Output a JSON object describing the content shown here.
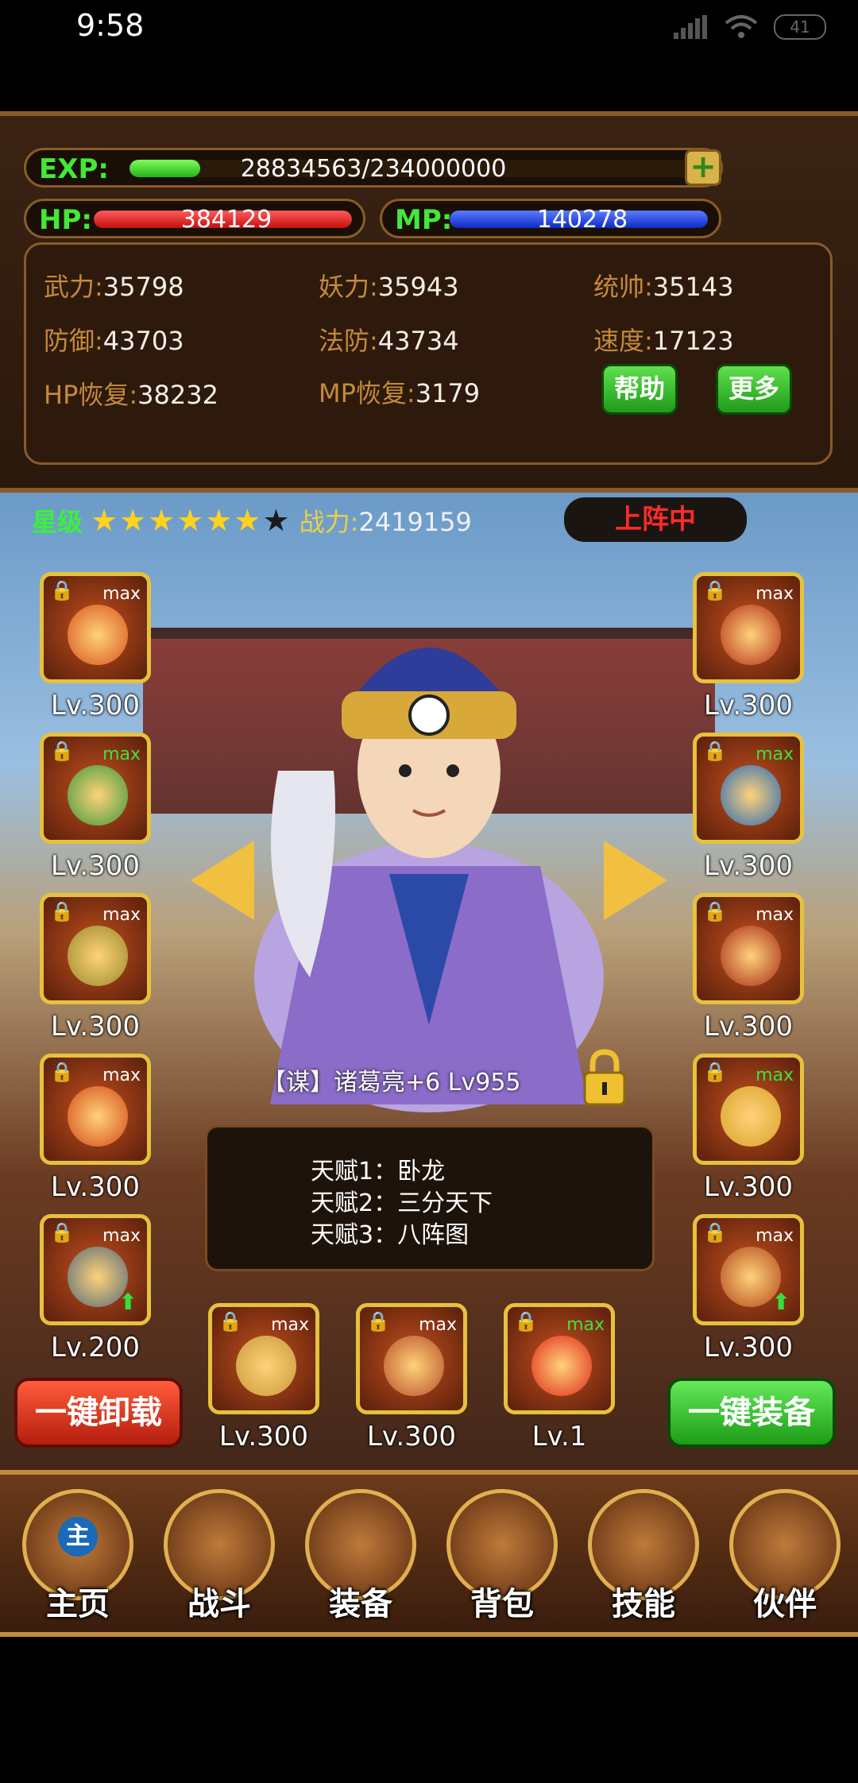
{
  "status_bar": {
    "time": "9:58",
    "battery": "41"
  },
  "stats": {
    "exp": {
      "label": "EXP:",
      "value": "28834563/234000000",
      "fraction": 0.123
    },
    "hp": {
      "label": "HP:",
      "value": "384129",
      "fraction": 1.0
    },
    "mp": {
      "label": "MP:",
      "value": "140278",
      "fraction": 1.0
    },
    "attributes": [
      {
        "key": "武力:",
        "value": "35798"
      },
      {
        "key": "妖力:",
        "value": "35943"
      },
      {
        "key": "统帅:",
        "value": "35143"
      },
      {
        "key": "防御:",
        "value": "43703"
      },
      {
        "key": "法防:",
        "value": "43734"
      },
      {
        "key": "速度:",
        "value": "17123"
      },
      {
        "key": "HP恢复:",
        "value": "38232"
      },
      {
        "key": "MP恢复:",
        "value": "3179"
      }
    ],
    "help_button": "帮助",
    "more_button": "更多"
  },
  "hero": {
    "star_label": "星级",
    "stars_filled": 6,
    "stars_total": 7,
    "power_label": "战力:",
    "power_value": "2419159",
    "deploy_status": "上阵中",
    "name": "【谋】诸葛亮+6 Lv955",
    "talents": [
      "天赋1：卧龙",
      "天赋2：三分天下",
      "天赋3：八阵图"
    ]
  },
  "equipment": {
    "left": [
      {
        "max": "max",
        "max_green": false,
        "level": "Lv.300",
        "color": "#d7541c",
        "upgrade": false
      },
      {
        "max": "max",
        "max_green": true,
        "level": "Lv.300",
        "color": "#3d9a3a",
        "upgrade": false
      },
      {
        "max": "max",
        "max_green": false,
        "level": "Lv.300",
        "color": "#9a8a2a",
        "upgrade": false
      },
      {
        "max": "max",
        "max_green": false,
        "level": "Lv.300",
        "color": "#d44a18",
        "upgrade": false
      },
      {
        "max": "max",
        "max_green": false,
        "level": "Lv.200",
        "color": "#556b7a",
        "upgrade": true
      }
    ],
    "right": [
      {
        "max": "max",
        "max_green": false,
        "level": "Lv.300",
        "color": "#b5301a",
        "upgrade": false
      },
      {
        "max": "max",
        "max_green": true,
        "level": "Lv.300",
        "color": "#2b6ab5",
        "upgrade": false
      },
      {
        "max": "max",
        "max_green": false,
        "level": "Lv.300",
        "color": "#a82a18",
        "upgrade": false
      },
      {
        "max": "max",
        "max_green": true,
        "level": "Lv.300",
        "color": "#d8a42a",
        "upgrade": false
      },
      {
        "max": "max",
        "max_green": false,
        "level": "Lv.300",
        "color": "#b2481c",
        "upgrade": true
      }
    ],
    "bottom": [
      {
        "max": "max",
        "max_green": false,
        "level": "Lv.300",
        "color": "#c89a3a",
        "upgrade": false
      },
      {
        "max": "max",
        "max_green": false,
        "level": "Lv.300",
        "color": "#b8502a",
        "upgrade": false
      },
      {
        "max": "max",
        "max_green": true,
        "level": "Lv.1",
        "color": "#e02a1a",
        "upgrade": false
      }
    ]
  },
  "buttons": {
    "unequip_all": "一键卸载",
    "equip_all": "一键装备"
  },
  "nav": [
    {
      "label": "主页"
    },
    {
      "label": "战斗"
    },
    {
      "label": "装备"
    },
    {
      "label": "背包"
    },
    {
      "label": "技能"
    },
    {
      "label": "伙伴"
    }
  ],
  "home_icon_glyph": "主"
}
